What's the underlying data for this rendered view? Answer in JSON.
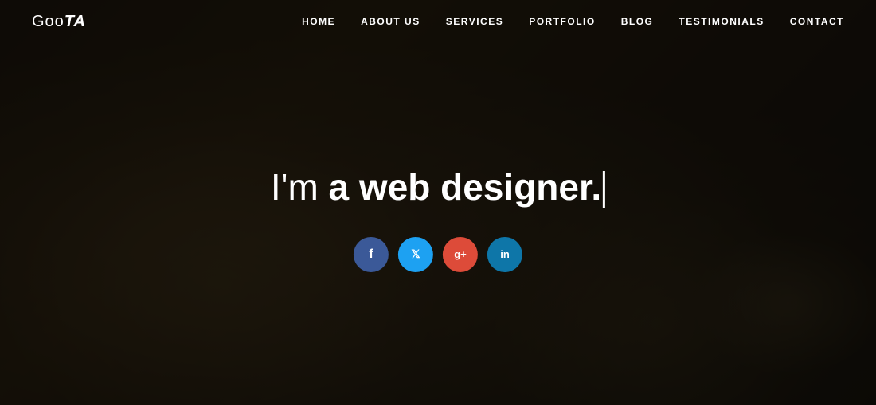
{
  "brand": {
    "logo_goo": "Goo",
    "logo_ta": "TA"
  },
  "nav": {
    "items": [
      {
        "label": "HOME",
        "href": "#"
      },
      {
        "label": "ABOUT US",
        "href": "#"
      },
      {
        "label": "SERVICES",
        "href": "#"
      },
      {
        "label": "PORTFOLIO",
        "href": "#"
      },
      {
        "label": "BLOG",
        "href": "#"
      },
      {
        "label": "TESTIMONIALS",
        "href": "#"
      },
      {
        "label": "CONTACT",
        "href": "#"
      }
    ]
  },
  "hero": {
    "title_normal": "I'm ",
    "title_bold": "a web designer."
  },
  "social": {
    "items": [
      {
        "name": "facebook",
        "icon": "f",
        "class": "facebook",
        "label": "Facebook"
      },
      {
        "name": "twitter",
        "icon": "t",
        "class": "twitter",
        "label": "Twitter"
      },
      {
        "name": "gplus",
        "icon": "g+",
        "class": "gplus",
        "label": "Google+"
      },
      {
        "name": "linkedin",
        "icon": "in",
        "class": "linkedin",
        "label": "LinkedIn"
      }
    ]
  }
}
